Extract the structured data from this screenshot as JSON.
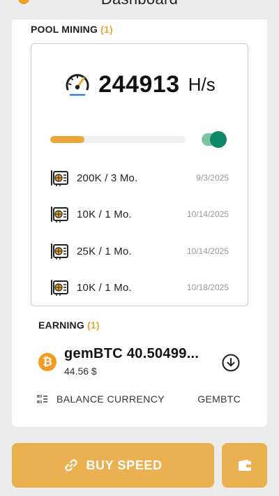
{
  "header": {
    "title": "Dashboard"
  },
  "pool": {
    "title": "POOL MINING",
    "count": "(1)",
    "speed_value": "244913",
    "speed_unit": "H/s",
    "progress": 0.25,
    "auto_mining_on": true,
    "plans": [
      {
        "label": "200K / 3 Mo.",
        "date": "9/3/2025"
      },
      {
        "label": "10K / 1 Mo.",
        "date": "10/14/2025"
      },
      {
        "label": "25K / 1 Mo.",
        "date": "10/14/2025"
      },
      {
        "label": "10K / 1 Mo.",
        "date": "10/18/2025"
      }
    ]
  },
  "earning": {
    "title": "EARNING",
    "count": "(1)",
    "coin_symbol": "₿",
    "name": "gemBTC 40.50499...",
    "fiat": "44.56 $",
    "balance_label": "BALANCE CURRENCY",
    "balance_value": "GEMBTC"
  },
  "actions": {
    "buy_label": "BUY SPEED"
  },
  "colors": {
    "accent": "#e9a63b",
    "button": "#ebb04f",
    "toggle_on": "#0c8a67",
    "bitcoin": "#f39a1e"
  },
  "icons": {
    "speed": "speedometer-icon",
    "plan": "mining-rig-icon",
    "coin": "bitcoin-icon",
    "withdraw": "download-circle-icon",
    "balance": "currency-list-icon",
    "buy": "link-icon",
    "wallet": "wallet-icon"
  }
}
